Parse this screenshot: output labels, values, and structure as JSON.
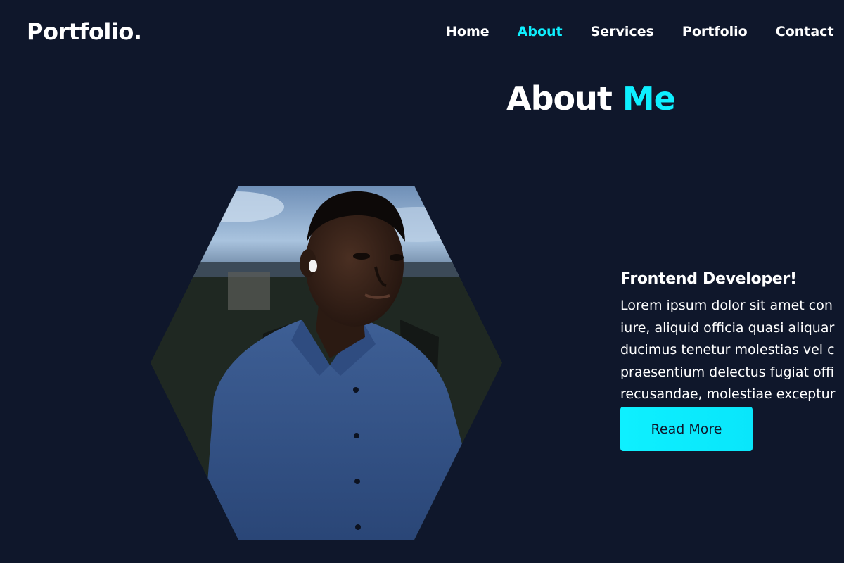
{
  "brand": {
    "logo": "Portfolio."
  },
  "nav": {
    "items": [
      {
        "label": "Home"
      },
      {
        "label": "About",
        "active": true
      },
      {
        "label": "Services"
      },
      {
        "label": "Portfolio"
      },
      {
        "label": "Contact"
      }
    ]
  },
  "about": {
    "heading_plain": "About",
    "heading_accent": "Me",
    "subtitle": "Frontend Developer!",
    "paragraph_lines": [
      "Lorem ipsum dolor sit amet con",
      "iure, aliquid officia quasi aliquar",
      "ducimus tenetur molestias vel c",
      "praesentium delectus fugiat offi",
      "recusandae, molestiae exceptur"
    ],
    "button_label": "Read More",
    "photo": "profile-photo"
  },
  "colors": {
    "background": "#0f172b",
    "accent": "#0ef0ff",
    "text": "#ffffff"
  }
}
